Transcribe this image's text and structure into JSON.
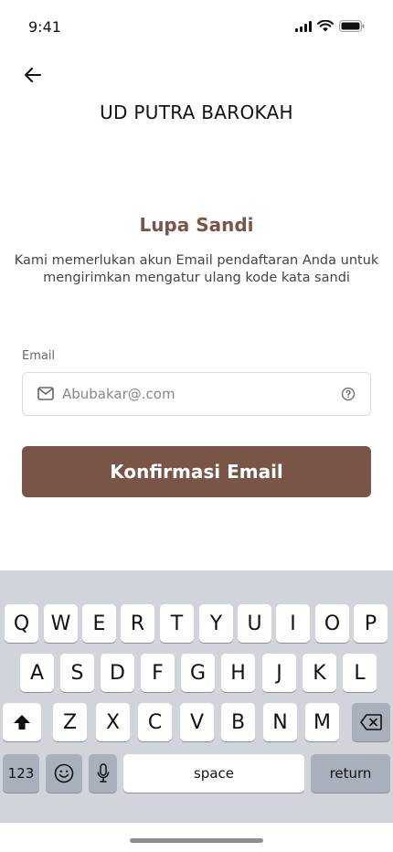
{
  "status_bar": {
    "time": "9:41"
  },
  "header": {
    "brand": "UD PUTRA BAROKAH"
  },
  "main": {
    "title": "Lupa Sandi",
    "subtitle": "Kami memerlukan akun Email pendaftaran Anda untuk mengirimkan mengatur ulang kode kata sandi",
    "email_label": "Email",
    "email_placeholder": "Abubakar@.com",
    "confirm_label": "Konfirmasi Email"
  },
  "keyboard": {
    "row1": [
      "Q",
      "W",
      "E",
      "R",
      "T",
      "Y",
      "U",
      "I",
      "O",
      "P"
    ],
    "row2": [
      "A",
      "S",
      "D",
      "F",
      "G",
      "H",
      "J",
      "K",
      "L"
    ],
    "row3": [
      "Z",
      "X",
      "C",
      "V",
      "B",
      "N",
      "M"
    ],
    "numbers_label": "123",
    "space_label": "space",
    "return_label": "return"
  },
  "colors": {
    "accent": "#795548",
    "title": "#7b5547",
    "keyboard_bg": "#d1d4da"
  }
}
